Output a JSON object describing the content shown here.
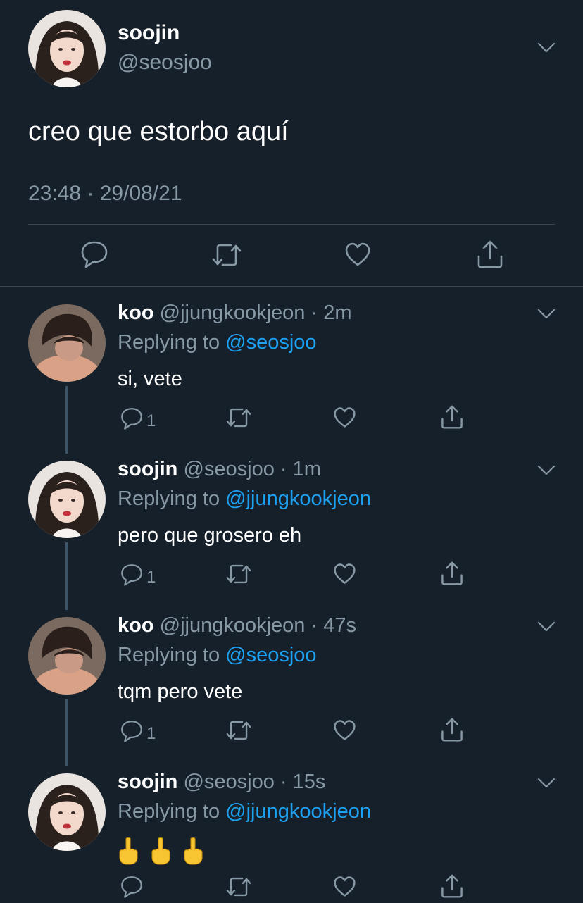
{
  "main_tweet": {
    "name": "soojin",
    "handle": "@seosjoo",
    "text": "creo que estorbo aquí",
    "timestamp": "23:48 · 29/08/21"
  },
  "replies": [
    {
      "name": "koo",
      "handle": "@jjungkookjeon",
      "time": "· 2m",
      "replying_label": "Replying to",
      "replying_to": "@seosjoo",
      "text": "si, vete",
      "reply_count": "1"
    },
    {
      "name": "soojin",
      "handle": "@seosjoo",
      "time": "· 1m",
      "replying_label": "Replying to",
      "replying_to": "@jjungkookjeon",
      "text": "pero que grosero eh",
      "reply_count": "1"
    },
    {
      "name": "koo",
      "handle": "@jjungkookjeon",
      "time": "· 47s",
      "replying_label": "Replying to",
      "replying_to": "@seosjoo",
      "text": "tqm pero vete",
      "reply_count": "1"
    },
    {
      "name": "soojin",
      "handle": "@seosjoo",
      "time": "· 15s",
      "replying_label": "Replying to",
      "replying_to": "@jjungkookjeon",
      "text": "🖕🖕🖕",
      "reply_count": ""
    }
  ],
  "icons": {
    "reply": "reply-icon",
    "retweet": "retweet-icon",
    "like": "heart-icon",
    "share": "share-icon",
    "more": "chevron-down-icon"
  },
  "colors": {
    "background": "#15202b",
    "text": "#ffffff",
    "muted": "#8899a6",
    "link": "#1da1f2",
    "divider": "#38444d"
  }
}
